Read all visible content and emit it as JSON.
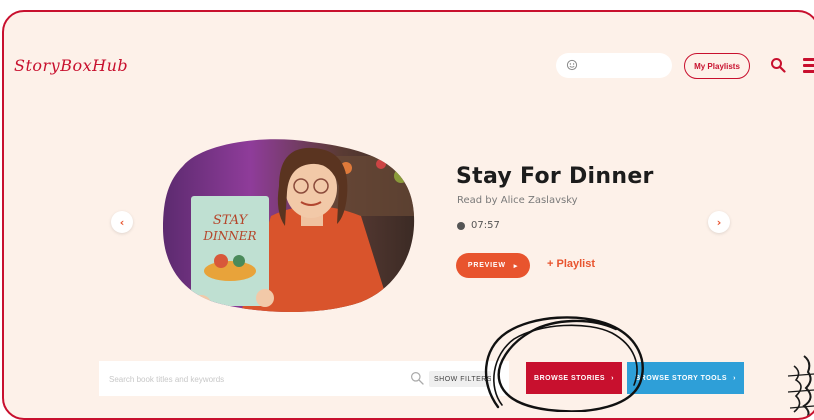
{
  "header": {
    "logo_text": "StoryBoxHub",
    "my_playlists_label": "My Playlists"
  },
  "hero": {
    "title": "Stay For Dinner",
    "reader": "Read by Alice Zaslavsky",
    "duration": "07:57",
    "preview_label": "PREVIEW",
    "add_playlist_label": "+ Playlist",
    "book_cover_title": "STAY FOR DINNER"
  },
  "search": {
    "placeholder": "Search book titles and keywords",
    "show_filters_label": "SHOW FILTERS"
  },
  "actions": {
    "browse_stories_label": "BROWSE STORIES",
    "browse_tools_label": "BROWSE STORY TOOLS"
  },
  "colors": {
    "brand_red": "#c8102e",
    "accent_orange": "#e8542e",
    "accent_blue": "#2e9fd8",
    "background": "#fdf1e9"
  },
  "icons": [
    "smiley-icon",
    "search-icon",
    "menu-icon",
    "chevron-left-icon",
    "chevron-right-icon",
    "clock-icon",
    "chevron-right-small-icon"
  ]
}
